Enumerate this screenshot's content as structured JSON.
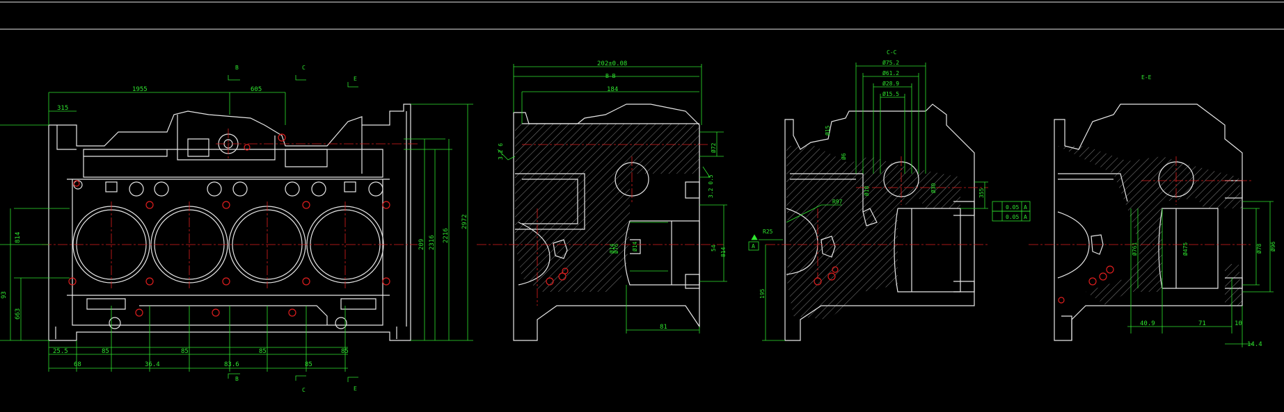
{
  "colors": {
    "background": "#000000",
    "outline": "#e8e8e8",
    "dimension": "#2fe62f",
    "centerline": "#e01e1e",
    "hatch": "#cfcfcf"
  },
  "views": {
    "front": {
      "top_dims": [
        "1955",
        "315",
        "605"
      ],
      "bottom_dims": [
        "25.5",
        "68",
        "85",
        "36.4",
        "85",
        "83.6",
        "85",
        "85",
        "85"
      ],
      "left_dims": [
        "814",
        "663",
        "93"
      ],
      "right_dims": [
        "209",
        "2316",
        "2216",
        "2972"
      ],
      "section_marks": [
        "B",
        "C",
        "E",
        "B",
        "C",
        "E"
      ]
    },
    "section_bb": {
      "title": "B-B",
      "top_dims": [
        "202±0.08",
        "B-B",
        "184"
      ],
      "side_dims": [
        "3.2 6",
        "Ø72",
        "3.2 0.5",
        "Ø76",
        "Ø14",
        "Ø14",
        "54",
        "814"
      ],
      "bottom_dims": [
        "81"
      ]
    },
    "section_cc": {
      "title": "C-C",
      "top_dims": [
        "Ø75.2",
        "Ø61.2",
        "Ø28.9",
        "Ø15.5"
      ],
      "side_dims": [
        "Ø15",
        "R97",
        "R25",
        "A",
        "Ø6",
        "Ø18",
        "Ø30",
        "355",
        "195"
      ],
      "tolerance": [
        "0.05",
        "A",
        "0.05",
        "A"
      ]
    },
    "section_ee": {
      "title": "E-E",
      "side_dims": [
        "Ø761",
        "Ø475",
        "Ø78",
        "Ø96"
      ],
      "bottom_dims": [
        "40.9",
        "71",
        "10",
        "14.4"
      ]
    }
  }
}
